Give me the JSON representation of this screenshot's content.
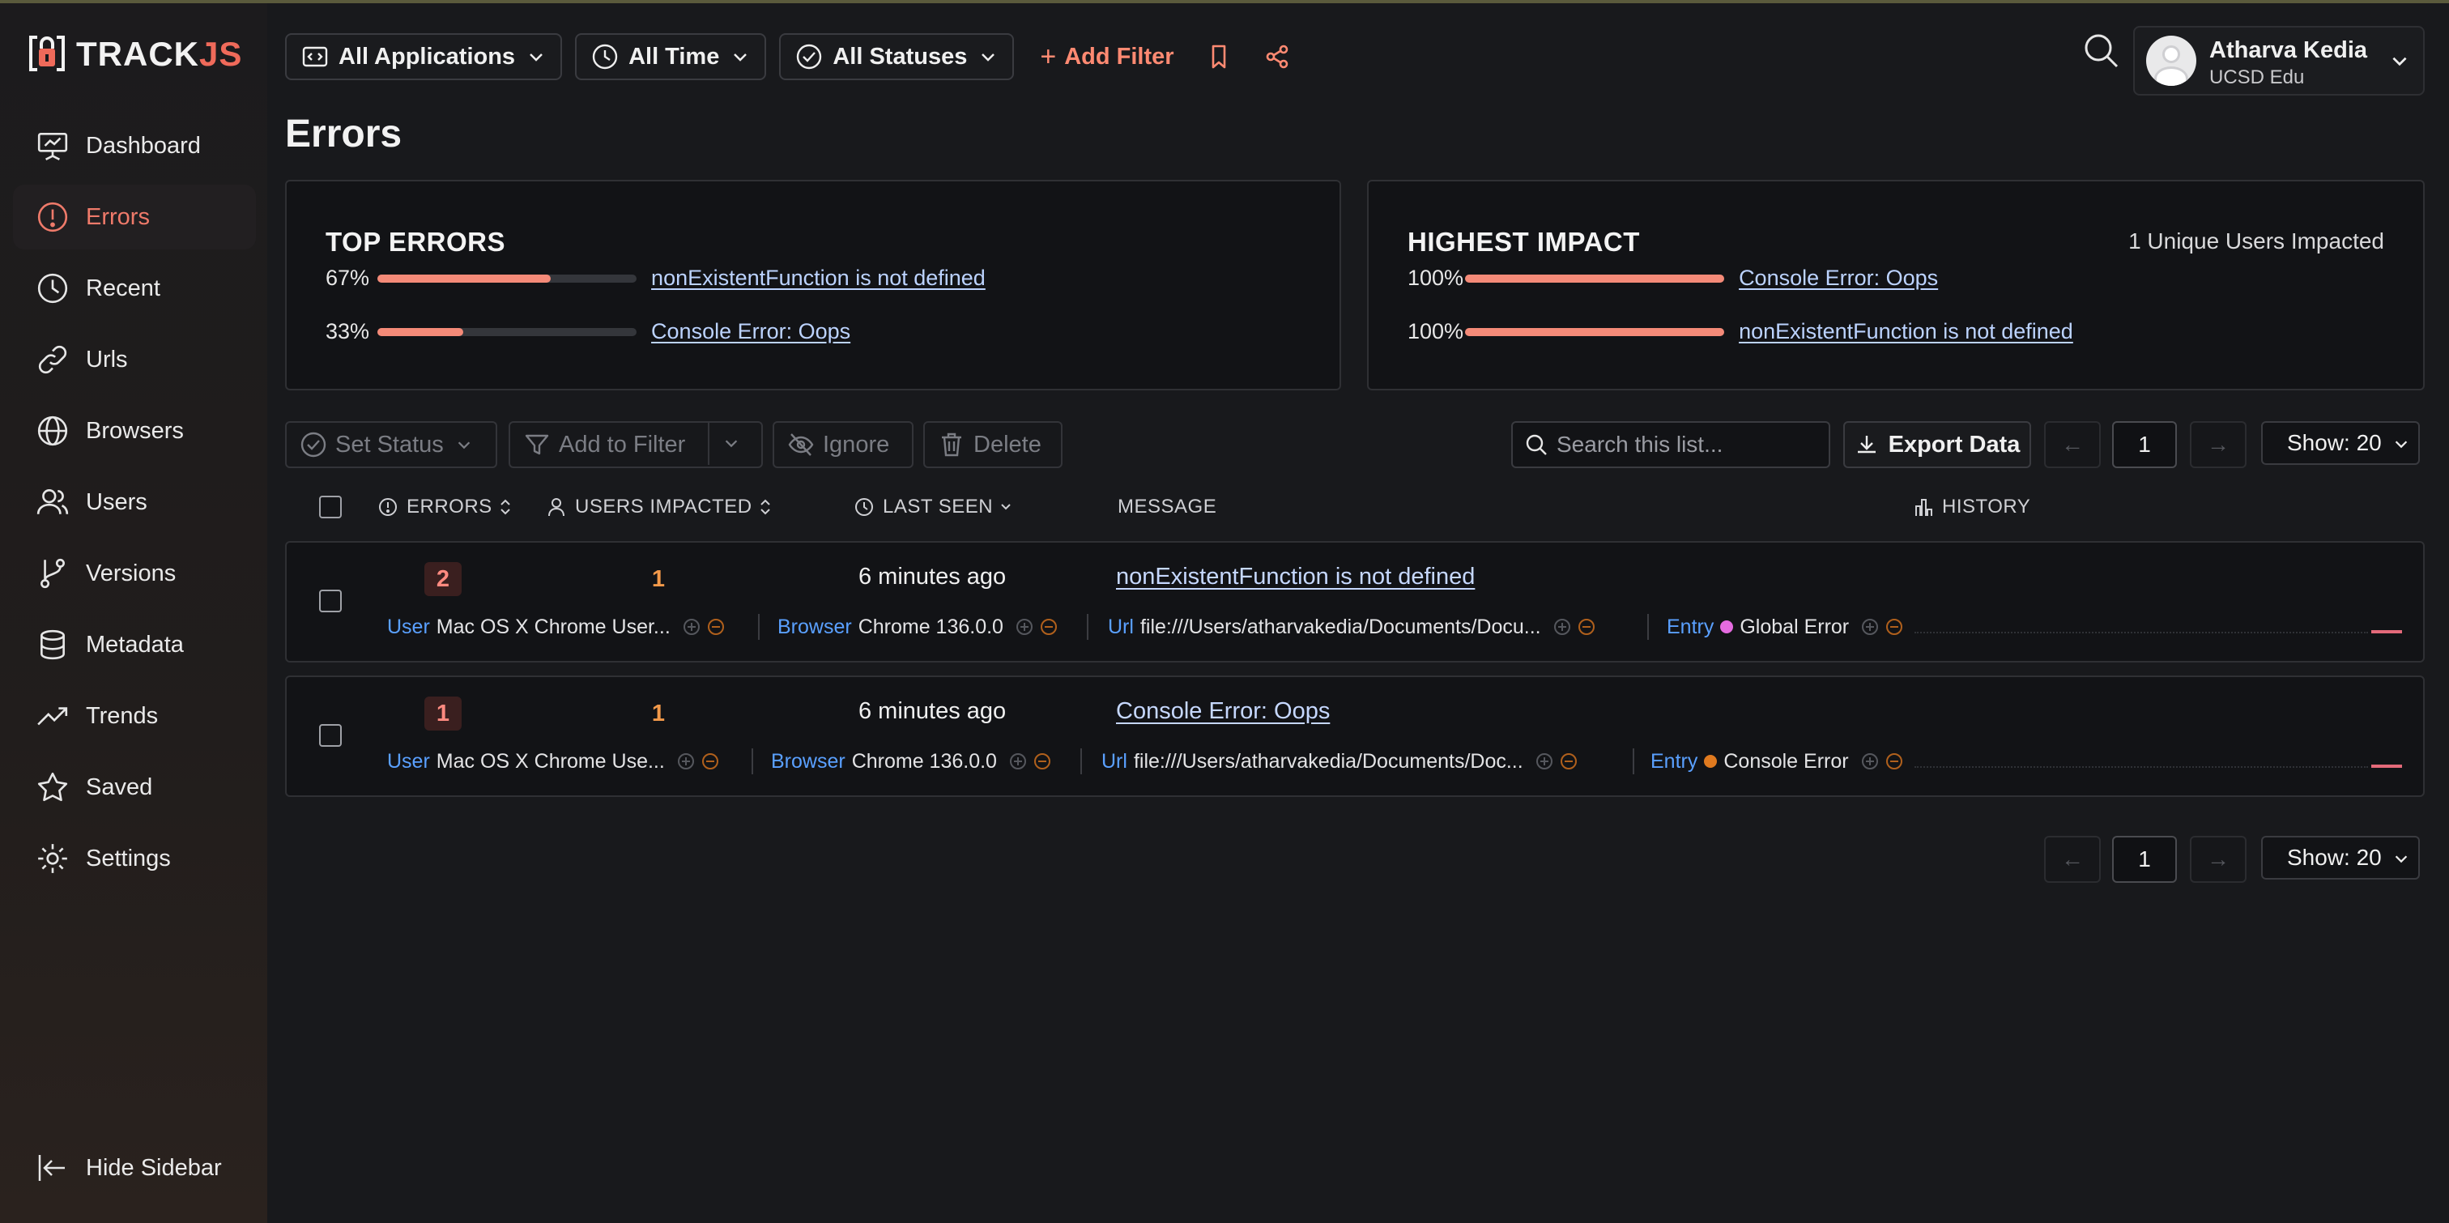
{
  "app": {
    "logo_text_a": "TRACK",
    "logo_text_b": "JS",
    "brand_color": "#ef6a5a"
  },
  "sidebar": {
    "items": [
      {
        "label": "Dashboard",
        "icon": "dashboard-icon"
      },
      {
        "label": "Errors",
        "icon": "error-icon",
        "active": true
      },
      {
        "label": "Recent",
        "icon": "clock-icon"
      },
      {
        "label": "Urls",
        "icon": "link-icon"
      },
      {
        "label": "Browsers",
        "icon": "globe-icon"
      },
      {
        "label": "Users",
        "icon": "users-icon"
      },
      {
        "label": "Versions",
        "icon": "branch-icon"
      },
      {
        "label": "Metadata",
        "icon": "database-icon"
      },
      {
        "label": "Trends",
        "icon": "trend-icon"
      },
      {
        "label": "Saved",
        "icon": "star-icon"
      },
      {
        "label": "Settings",
        "icon": "gear-icon"
      }
    ],
    "hide_label": "Hide Sidebar"
  },
  "toolbar": {
    "applications": "All Applications",
    "time": "All Time",
    "statuses": "All Statuses",
    "add_filter": "Add Filter"
  },
  "user": {
    "name": "Atharva Kedia",
    "org": "UCSD Edu"
  },
  "page": {
    "title": "Errors"
  },
  "top_errors": {
    "title": "TOP ERRORS",
    "rows": [
      {
        "pct": "67%",
        "fraction": 0.67,
        "message": "nonExistentFunction is not defined"
      },
      {
        "pct": "33%",
        "fraction": 0.33,
        "message": "Console Error: Oops"
      }
    ]
  },
  "highest_impact": {
    "title": "HIGHEST IMPACT",
    "summary": "1 Unique Users Impacted",
    "rows": [
      {
        "pct": "100%",
        "fraction": 1.0,
        "message": "Console Error: Oops"
      },
      {
        "pct": "100%",
        "fraction": 1.0,
        "message": "nonExistentFunction is not defined"
      }
    ]
  },
  "actions": {
    "set_status": "Set Status",
    "add_to_filter": "Add to Filter",
    "ignore": "Ignore",
    "delete": "Delete",
    "search_placeholder": "Search this list...",
    "export": "Export Data",
    "page": "1",
    "show": "Show: 20"
  },
  "table": {
    "headers": {
      "errors": "ERRORS",
      "users": "USERS IMPACTED",
      "last_seen": "LAST SEEN",
      "message": "MESSAGE",
      "history": "HISTORY"
    },
    "rows": [
      {
        "errors": "2",
        "users": "1",
        "last_seen": "6 minutes ago",
        "message": "nonExistentFunction is not defined",
        "user_label": "User",
        "user_value": "Mac OS X Chrome User...",
        "browser_label": "Browser",
        "browser_value": "Chrome 136.0.0",
        "url_label": "Url",
        "url_value": "file:///Users/atharvakedia/Documents/Docu...",
        "entry_label": "Entry",
        "entry_value": "Global Error",
        "entry_color": "#e56be0"
      },
      {
        "errors": "1",
        "users": "1",
        "last_seen": "6 minutes ago",
        "message": "Console Error: Oops",
        "user_label": "User",
        "user_value": "Mac OS X Chrome Use...",
        "browser_label": "Browser",
        "browser_value": "Chrome 136.0.0",
        "url_label": "Url",
        "url_value": "file:///Users/atharvakedia/Documents/Doc...",
        "entry_label": "Entry",
        "entry_value": "Console Error",
        "entry_color": "#e07a1f"
      }
    ]
  },
  "bottom_pager": {
    "page": "1",
    "show": "Show: 20"
  }
}
